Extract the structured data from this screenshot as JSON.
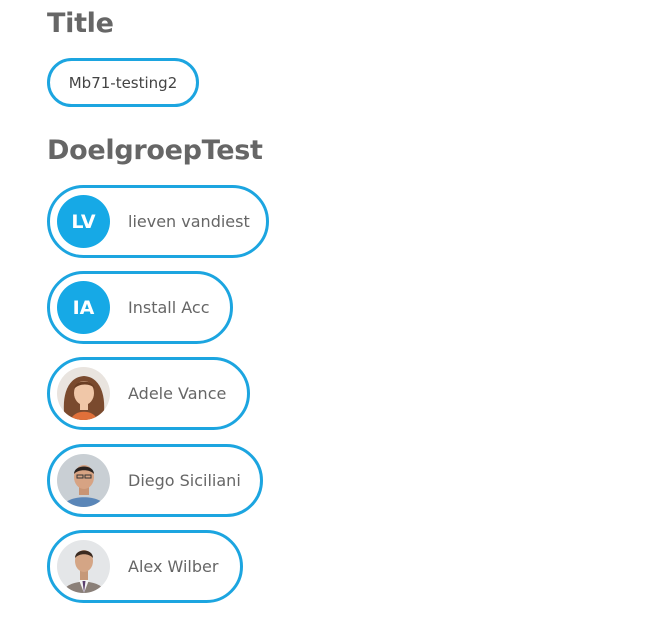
{
  "title_section": {
    "heading": "Title",
    "value": "Mb71-testing2"
  },
  "group_section": {
    "heading": "DoelgroepTest",
    "members": [
      {
        "name": "lieven vandiest",
        "initials": "LV"
      },
      {
        "name": "Install Acc",
        "initials": "IA"
      },
      {
        "name": "Adele Vance",
        "avatar": "photo-avatar"
      },
      {
        "name": "Diego Siciliani",
        "avatar": "photo-avatar"
      },
      {
        "name": "Alex Wilber",
        "avatar": "photo-avatar"
      }
    ]
  },
  "colors": {
    "accent": "#1ca5e0",
    "avatar_bg": "#16a9e6",
    "heading_text": "#666666"
  }
}
